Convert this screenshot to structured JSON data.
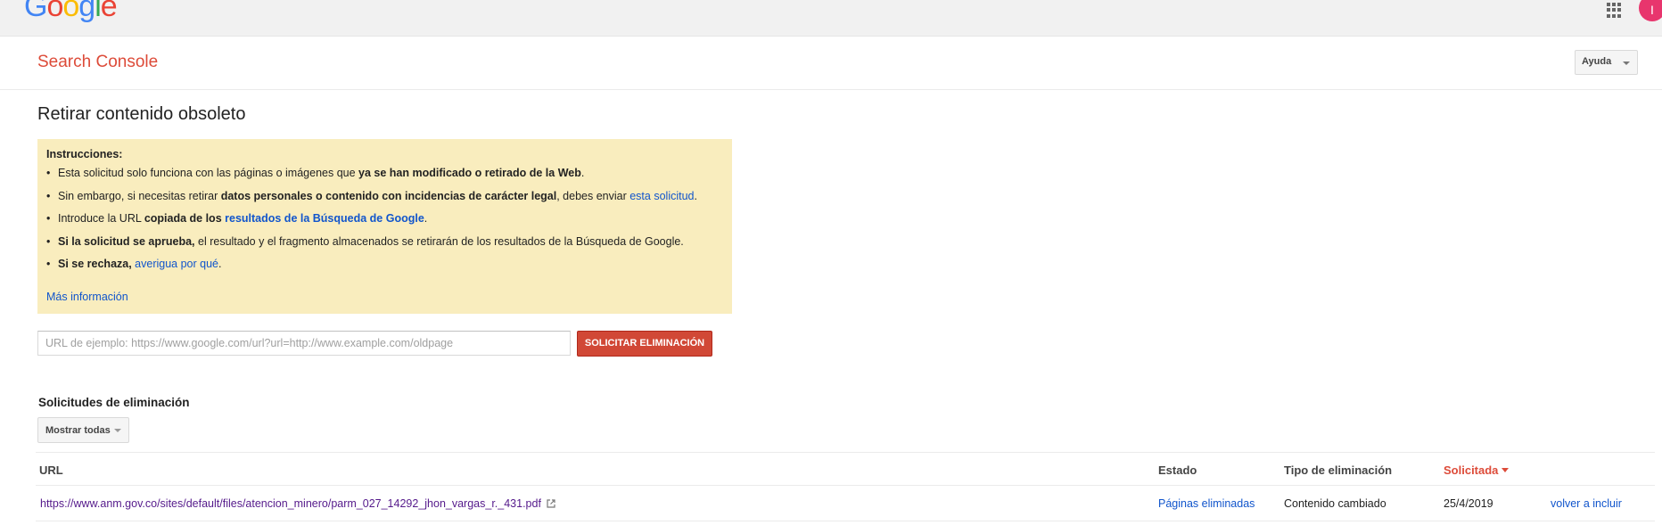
{
  "header": {
    "logo": [
      "G",
      "o",
      "o",
      "g",
      "l",
      "e"
    ],
    "logo_colors": [
      "#4285f4",
      "#ea4335",
      "#fbbc05",
      "#4285f4",
      "#34a853",
      "#ea4335"
    ],
    "avatar_letter": "I",
    "avatar_color": "#e8356d"
  },
  "subheader": {
    "product": "Search Console",
    "help_label": "Ayuda"
  },
  "page": {
    "title": "Retirar contenido obsoleto"
  },
  "instructions": {
    "heading": "Instrucciones:",
    "items": [
      {
        "t1": "Esta solicitud solo funciona con las páginas o imágenes que ",
        "b1": "ya se han modificado o retirado de la Web",
        "t2": "."
      },
      {
        "t1": "Sin embargo, si necesitas retirar ",
        "b1": "datos personales o contenido con incidencias de carácter legal",
        "t2": ", debes enviar ",
        "link": "esta solicitud",
        "t3": "."
      },
      {
        "t1": "Introduce la URL ",
        "b1": "copiada de los ",
        "link": "resultados de la Búsqueda de Google",
        "t2": "."
      },
      {
        "b1": "Si la solicitud se aprueba,",
        "t1": " el resultado y el fragmento almacenados se retirarán de los resultados de la Búsqueda de Google."
      },
      {
        "b1": "Si se rechaza,",
        "link": " averigua por qué",
        "t1": "."
      }
    ],
    "more_info": "Más información"
  },
  "form": {
    "url_placeholder": "URL de ejemplo: https://www.google.com/url?url=http://www.example.com/oldpage",
    "url_value": "",
    "submit_label": "SOLICITAR ELIMINACIÓN"
  },
  "requests": {
    "title": "Solicitudes de eliminación",
    "filter_label": "Mostrar todas",
    "columns": {
      "url": "URL",
      "state": "Estado",
      "type": "Tipo de eliminación",
      "requested": "Solicitada"
    },
    "rows": [
      {
        "url": "https://www.anm.gov.co/sites/default/files/atencion_minero/parm_027_14292_jhon_vargas_r._431.pdf",
        "state": "Páginas eliminadas",
        "type": "Contenido cambiado",
        "date": "25/4/2019",
        "action": "volver a incluir"
      }
    ]
  }
}
